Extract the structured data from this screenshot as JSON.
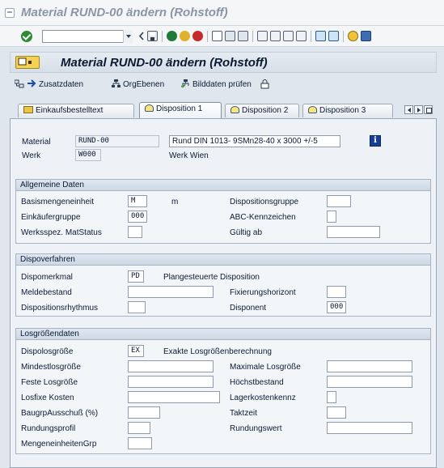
{
  "window": {
    "title": "Material RUND-00 ändern (Rohstoff)"
  },
  "screen_title": {
    "badge": "Sicht",
    "text": "Material RUND-00 ändern (Rohstoff)"
  },
  "toolbar": {
    "command_value": ""
  },
  "app_toolbar": {
    "zusatzdaten": "Zusatzdaten",
    "orgebenen": "OrgEbenen",
    "bilddaten": "Bilddaten prüfen"
  },
  "tabs": [
    {
      "label": "Einkaufsbestelltext"
    },
    {
      "label": "Disposition 1"
    },
    {
      "label": "Disposition 2"
    },
    {
      "label": "Disposition 3"
    }
  ],
  "header": {
    "material_label": "Material",
    "material_value": "RUND-00",
    "material_desc": "Rund  DIN 1013- 9SMn28-40 x 3000 +/-5",
    "werk_label": "Werk",
    "werk_value": "W000",
    "werk_desc": "Werk Wien"
  },
  "allgemeine": {
    "title": "Allgemeine Daten",
    "basis_label": "Basismengeneinheit",
    "basis_value": "M",
    "basis_unit": "m",
    "dispogruppe_label": "Dispositionsgruppe",
    "dispogruppe_value": "",
    "einkaeufer_label": "Einkäufergruppe",
    "einkaeufer_value": "000",
    "abc_label": "ABC-Kennzeichen",
    "abc_value": "",
    "werksstatus_label": "Werksspez. MatStatus",
    "werksstatus_value": "",
    "gueltig_label": "Gültig ab",
    "gueltig_value": ""
  },
  "dispoverfahren": {
    "title": "Dispoverfahren",
    "merkmal_label": "Dispomerkmal",
    "merkmal_value": "PD",
    "merkmal_desc": "Plangesteuerte Disposition",
    "meldebestand_label": "Meldebestand",
    "meldebestand_value": "",
    "fixierung_label": "Fixierungshorizont",
    "fixierung_value": "",
    "rhythmus_label": "Dispositionsrhythmus",
    "rhythmus_value": "",
    "disponent_label": "Disponent",
    "disponent_value": "000"
  },
  "losgroessen": {
    "title": "Losgrößendaten",
    "dispolos_label": "Dispolosgröße",
    "dispolos_value": "EX",
    "dispolos_desc": "Exakte Losgrößenberechnung",
    "min_label": "Mindestlosgröße",
    "min_value": "",
    "max_label": "Maximale Losgröße",
    "max_value": "",
    "fest_label": "Feste Losgröße",
    "fest_value": "",
    "hoechst_label": "Höchstbestand",
    "hoechst_value": "",
    "losfix_label": "Losfixe Kosten",
    "losfix_value": "",
    "lagerkosten_label": "Lagerkostenkennz",
    "lagerkosten_value": "",
    "baugrp_label": "BaugrpAusschuß (%)",
    "baugrp_value": "",
    "taktzeit_label": "Taktzeit",
    "taktzeit_value": "",
    "rprofil_label": "Rundungsprofil",
    "rprofil_value": "",
    "rwert_label": "Rundungswert",
    "rwert_value": "",
    "mengengrp_label": "MengeneinheitenGrp",
    "mengengrp_value": ""
  }
}
